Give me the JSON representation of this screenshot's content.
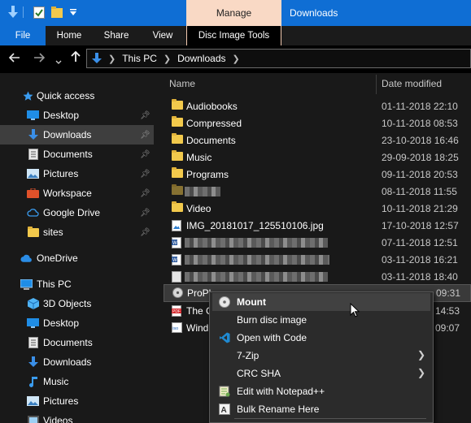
{
  "titlebar": {
    "manage_label": "Manage",
    "window_title": "Downloads"
  },
  "ribbon": {
    "tabs": [
      "File",
      "Home",
      "Share",
      "View",
      "Disc Image Tools"
    ]
  },
  "address": {
    "crumbs": [
      "This PC",
      "Downloads"
    ]
  },
  "nav": {
    "items": [
      {
        "label": "Quick access",
        "icon": "star-icon"
      },
      {
        "label": "Desktop",
        "icon": "desktop-icon",
        "pinned": true
      },
      {
        "label": "Downloads",
        "icon": "download-arrow-icon",
        "pinned": true,
        "selected": true
      },
      {
        "label": "Documents",
        "icon": "document-icon",
        "pinned": true
      },
      {
        "label": "Pictures",
        "icon": "pictures-icon",
        "pinned": true
      },
      {
        "label": "Workspace",
        "icon": "briefcase-icon",
        "pinned": true
      },
      {
        "label": "Google Drive",
        "icon": "google-drive-icon",
        "pinned": true
      },
      {
        "label": "sites",
        "icon": "folder-icon",
        "pinned": true
      },
      {
        "label": "OneDrive",
        "icon": "cloud-icon"
      },
      {
        "label": "This PC",
        "icon": "computer-icon"
      },
      {
        "label": "3D Objects",
        "icon": "cube-icon"
      },
      {
        "label": "Desktop",
        "icon": "desktop-icon"
      },
      {
        "label": "Documents",
        "icon": "document-icon"
      },
      {
        "label": "Downloads",
        "icon": "download-arrow-icon"
      },
      {
        "label": "Music",
        "icon": "music-note-icon"
      },
      {
        "label": "Pictures",
        "icon": "pictures-icon"
      },
      {
        "label": "Videos",
        "icon": "video-icon"
      }
    ]
  },
  "files": {
    "col_name": "Name",
    "col_date": "Date modified",
    "rows": [
      {
        "name": "Audiobooks",
        "date": "01-11-2018 22:10",
        "icon": "folder-icon"
      },
      {
        "name": "Compressed",
        "date": "10-11-2018 08:53",
        "icon": "folder-icon"
      },
      {
        "name": "Documents",
        "date": "23-10-2018 16:46",
        "icon": "folder-icon"
      },
      {
        "name": "Music",
        "date": "29-09-2018 18:25",
        "icon": "folder-icon"
      },
      {
        "name": "Programs",
        "date": "09-11-2018 20:53",
        "icon": "folder-icon"
      },
      {
        "name": "",
        "date": "08-11-2018 11:55",
        "icon": "folder-icon",
        "redacted": true
      },
      {
        "name": "Video",
        "date": "10-11-2018 21:29",
        "icon": "folder-icon"
      },
      {
        "name": "IMG_20181017_125510106.jpg",
        "date": "17-10-2018 12:57",
        "icon": "image-file-icon"
      },
      {
        "name": "",
        "date": "07-11-2018 12:51",
        "icon": "word-file-icon",
        "redacted": true
      },
      {
        "name": "",
        "date": "03-11-2018 16:21",
        "icon": "word-file-icon",
        "redacted": true
      },
      {
        "name": "",
        "date": "03-11-2018 18:40",
        "icon": "blank-file-icon",
        "redacted": true
      },
      {
        "name": "ProPl",
        "date": "09:31",
        "icon": "disc-image-icon",
        "selected": true
      },
      {
        "name": "The C",
        "date": "14:53",
        "icon": "pdf-file-icon"
      },
      {
        "name": "Wind",
        "date": "09:07",
        "icon": "iso-file-icon"
      }
    ]
  },
  "context_menu": {
    "items": [
      {
        "label": "Mount",
        "icon": "disc-icon"
      },
      {
        "label": "Burn disc image",
        "icon": ""
      },
      {
        "label": "Open with Code",
        "icon": "vscode-icon"
      },
      {
        "label": "7-Zip",
        "icon": "",
        "submenu": true
      },
      {
        "label": "CRC SHA",
        "icon": "",
        "submenu": true
      },
      {
        "label": "Edit with Notepad++",
        "icon": "notepad-plus-icon"
      },
      {
        "label": "Bulk Rename Here",
        "icon": "bulk-rename-icon"
      }
    ]
  },
  "colors": {
    "accent": "#0f6ed4",
    "manage_tab": "#f9d9c5",
    "folder": "#f2c94c",
    "background": "#191919"
  }
}
